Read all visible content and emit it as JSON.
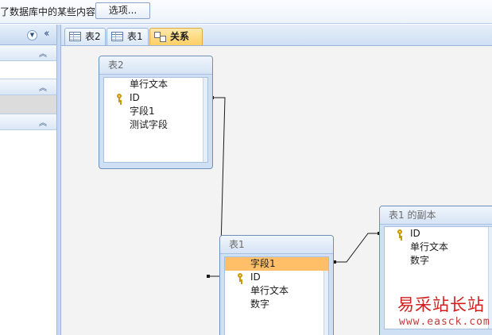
{
  "message_bar": {
    "text": "了数据库中的某些内容",
    "options_button": "选项..."
  },
  "nav_pane": {
    "dropdown_icon": "chevron-down-circle-icon",
    "collapse_icon": "double-chevron-left-icon",
    "group_toggle_icon": "double-chevron-up-icon"
  },
  "tabs": [
    {
      "label": "表2",
      "icon": "table-icon"
    },
    {
      "label": "表1",
      "icon": "table-icon"
    },
    {
      "label": "关系",
      "icon": "relationships-icon",
      "active": true
    }
  ],
  "field_lists": {
    "t2": {
      "title": "表2",
      "fields": [
        {
          "name": "单行文本",
          "key": false
        },
        {
          "name": "ID",
          "key": true
        },
        {
          "name": "字段1",
          "key": false
        },
        {
          "name": "测试字段",
          "key": false
        }
      ]
    },
    "t1": {
      "title": "表1",
      "fields": [
        {
          "name": "字段1",
          "key": false,
          "selected": true
        },
        {
          "name": "ID",
          "key": true
        },
        {
          "name": "单行文本",
          "key": false
        },
        {
          "name": "数字",
          "key": false
        }
      ]
    },
    "t1copy": {
      "title": "表1 的副本",
      "fields": [
        {
          "name": "ID",
          "key": true
        },
        {
          "name": "单行文本",
          "key": false
        },
        {
          "name": "数字",
          "key": false
        }
      ]
    }
  },
  "watermark": {
    "cn": "易采站长站",
    "en": "www.easck.com"
  }
}
